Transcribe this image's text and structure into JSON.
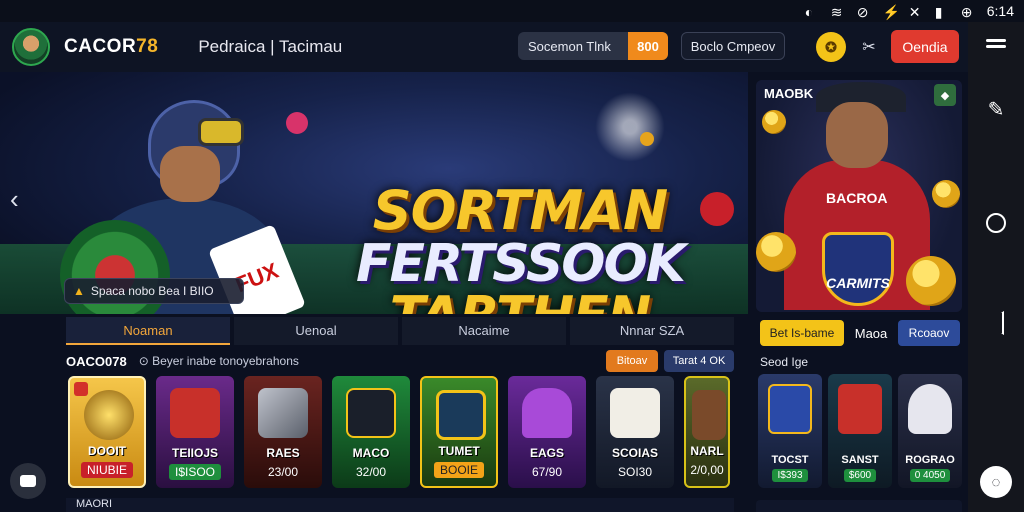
{
  "statusbar": {
    "time": "6:14"
  },
  "header": {
    "brand_main": "CACOR",
    "brand_num": "78",
    "nav_title": "Pedraica | Tacimau",
    "sport_label": "Socemon Tlnk",
    "sport_amount": "800",
    "compare_label": "Boclo Cmpeov",
    "cta_label": "Oendia"
  },
  "hero": {
    "title_line1": "SORTMAN",
    "title_line2": "FERTSSOOK",
    "title_line3": "TARTHEN",
    "badge_text": "Spaca nobo Bea I BIIO",
    "card_text": "FUX"
  },
  "promo": {
    "tag": "MAOBK",
    "jersey_text": "BACROA",
    "crest_text": "CARMITS"
  },
  "tabs": [
    {
      "label": "Noaman"
    },
    {
      "label": "Uenoal"
    },
    {
      "label": "Nacaime"
    },
    {
      "label": "Nnnar SZA"
    }
  ],
  "section": {
    "title": "OACO078",
    "subtitle": "⊙ Beyer inabe tonoyebrahons",
    "btn1": "Bitoav",
    "btn2": "Tarat 4 OK"
  },
  "games": [
    {
      "name": "DOOIT",
      "price": "NIUBIE"
    },
    {
      "name": "TEIIOJS",
      "price": "I$ISOO"
    },
    {
      "name": "RAES",
      "price": "23/00"
    },
    {
      "name": "MACO",
      "price": "32/00"
    },
    {
      "name": "TUMET",
      "price": "BOOIE"
    },
    {
      "name": "EAGS",
      "price": "67/90"
    },
    {
      "name": "SCOIAS",
      "price": "SOI30"
    },
    {
      "name": "NARL",
      "price": "2/0,00"
    }
  ],
  "side": {
    "btn1": "Bet Is-bame",
    "btn2": "Maoa",
    "btn3": "Rcoaov",
    "label": "Seod Ige",
    "cards": [
      {
        "name": "TOCST",
        "price": "I$393"
      },
      {
        "name": "SANST",
        "price": "$600"
      },
      {
        "name": "ROGRAO",
        "price": "0 4050"
      }
    ]
  },
  "bottom": {
    "text": "MAORI"
  },
  "colors": {
    "accent": "#f2a63b",
    "cta": "#e03a2f",
    "gold": "#f3c318",
    "bg": "#0b1020"
  }
}
